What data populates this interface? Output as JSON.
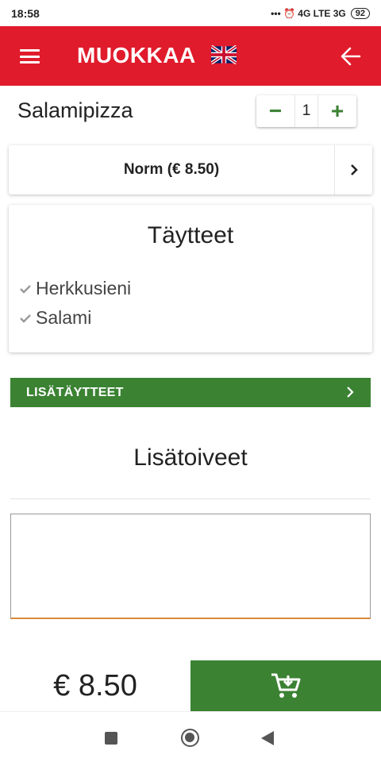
{
  "status": {
    "time": "18:58",
    "indicators": "••• ⏰ 4G  LTE 3G",
    "battery": "92"
  },
  "appbar": {
    "title": "MUOKKAA",
    "icons": [
      "menu-icon",
      "uk-flag-icon",
      "arrow-left-icon"
    ]
  },
  "product": {
    "name": "Salamipizza",
    "quantity": "1",
    "decrement_symbol": "−",
    "increment_symbol": "+"
  },
  "size": {
    "label": "Norm (€ 8.50)"
  },
  "toppings": {
    "title": "Täytteet",
    "items": [
      "Herkkusieni",
      "Salami"
    ]
  },
  "extras": {
    "label": "LISÄTÄYTTEET"
  },
  "wishes": {
    "title": "Lisätoiveet",
    "value": ""
  },
  "footer": {
    "price": "€ 8.50",
    "cart_icon": "add-to-cart-icon"
  },
  "colors": {
    "appbar": "#e01b2c",
    "accent_green": "#3b8233",
    "input_underline": "#d98b3a"
  }
}
